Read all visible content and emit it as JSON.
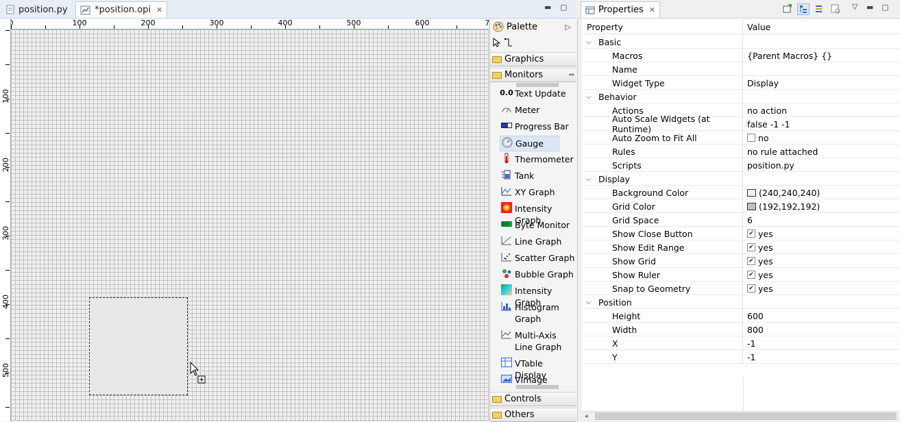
{
  "editor": {
    "tabs": [
      {
        "label": "position.py",
        "icon": "python-file-icon"
      },
      {
        "label": "*position.opi",
        "icon": "opi-file-icon"
      }
    ]
  },
  "ruler": {
    "h_labels": [
      "0",
      "100",
      "200",
      "300",
      "400",
      "500",
      "600",
      "7"
    ],
    "v_labels": [
      "100",
      "200",
      "300",
      "400",
      "500"
    ]
  },
  "palette": {
    "title": "Palette",
    "drawers": {
      "graphics": "Graphics",
      "monitors": "Monitors",
      "controls": "Controls",
      "others": "Others"
    },
    "selected_item": "Gauge",
    "items": [
      {
        "label": "Text Update",
        "icon": "text-update-icon",
        "glyph": "0.0"
      },
      {
        "label": "Meter",
        "icon": "meter-icon"
      },
      {
        "label": "Progress Bar",
        "icon": "progress-bar-icon"
      },
      {
        "label": "Gauge",
        "icon": "gauge-icon"
      },
      {
        "label": "Thermometer",
        "icon": "thermometer-icon"
      },
      {
        "label": "Tank",
        "icon": "tank-icon"
      },
      {
        "label": "XY Graph",
        "icon": "xy-graph-icon"
      },
      {
        "label": "Intensity Graph",
        "icon": "intensity-graph-icon"
      },
      {
        "label": "Byte Monitor",
        "icon": "byte-monitor-icon"
      },
      {
        "label": "Line Graph",
        "icon": "line-graph-icon"
      },
      {
        "label": "Scatter Graph",
        "icon": "scatter-graph-icon"
      },
      {
        "label": "Bubble Graph",
        "icon": "bubble-graph-icon"
      },
      {
        "label": "Intensity Graph",
        "icon": "intensity-graph-color-icon"
      },
      {
        "label": "Histogram Graph",
        "icon": "histogram-graph-icon"
      },
      {
        "label": "Multi-Axis Line Graph",
        "icon": "multi-axis-line-graph-icon"
      },
      {
        "label": "VTable Display",
        "icon": "vtable-display-icon"
      },
      {
        "label": "VImage",
        "icon": "vimage-icon"
      }
    ]
  },
  "properties": {
    "tab_label": "Properties",
    "col_property": "Property",
    "col_value": "Value",
    "rows": [
      {
        "kind": "category",
        "name": "Basic"
      },
      {
        "kind": "prop",
        "name": "Macros",
        "value": "{Parent Macros} {}"
      },
      {
        "kind": "prop",
        "name": "Name",
        "value": ""
      },
      {
        "kind": "prop",
        "name": "Widget Type",
        "value": "Display"
      },
      {
        "kind": "category",
        "name": "Behavior"
      },
      {
        "kind": "prop",
        "name": "Actions",
        "value": "no action"
      },
      {
        "kind": "prop",
        "name": "Auto Scale Widgets (at Runtime)",
        "value": "false -1 -1"
      },
      {
        "kind": "prop",
        "name": "Auto Zoom to Fit All",
        "value": "no",
        "checkbox": false
      },
      {
        "kind": "prop",
        "name": "Rules",
        "value": "no rule attached"
      },
      {
        "kind": "prop",
        "name": "Scripts",
        "value": "position.py"
      },
      {
        "kind": "category",
        "name": "Display"
      },
      {
        "kind": "prop",
        "name": "Background Color",
        "value": "(240,240,240)",
        "swatch": "#f0f0f0"
      },
      {
        "kind": "prop",
        "name": "Grid Color",
        "value": "(192,192,192)",
        "swatch": "#c0c0c0"
      },
      {
        "kind": "prop",
        "name": "Grid Space",
        "value": "6"
      },
      {
        "kind": "prop",
        "name": "Show Close Button",
        "value": "yes",
        "checkbox": true
      },
      {
        "kind": "prop",
        "name": "Show Edit Range",
        "value": "yes",
        "checkbox": true
      },
      {
        "kind": "prop",
        "name": "Show Grid",
        "value": "yes",
        "checkbox": true
      },
      {
        "kind": "prop",
        "name": "Show Ruler",
        "value": "yes",
        "checkbox": true
      },
      {
        "kind": "prop",
        "name": "Snap to Geometry",
        "value": "yes",
        "checkbox": true
      },
      {
        "kind": "category",
        "name": "Position"
      },
      {
        "kind": "prop",
        "name": "Height",
        "value": "600"
      },
      {
        "kind": "prop",
        "name": "Width",
        "value": "800"
      },
      {
        "kind": "prop",
        "name": "X",
        "value": "-1"
      },
      {
        "kind": "prop",
        "name": "Y",
        "value": "-1"
      }
    ]
  },
  "colors": {
    "grid": "#c0c0c0",
    "canvas_bg": "#f0f0f0",
    "selection": "#dbe7f7"
  }
}
